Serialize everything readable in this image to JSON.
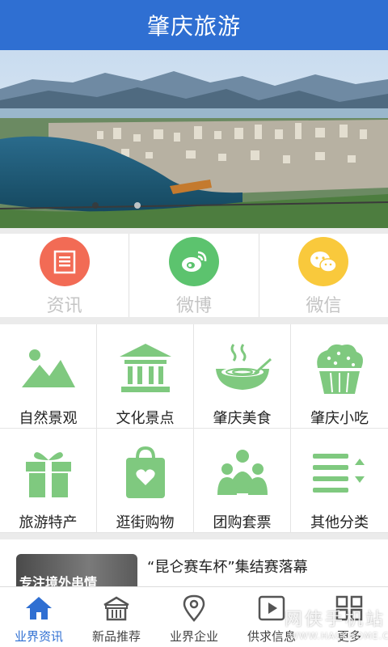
{
  "header": {
    "title": "肇庆旅游"
  },
  "banner": {
    "slides": 2,
    "active_index": 0
  },
  "social": [
    {
      "label": "资讯",
      "icon": "news-icon",
      "color": "#f26b55"
    },
    {
      "label": "微博",
      "icon": "weibo-icon",
      "color": "#5cc36e"
    },
    {
      "label": "微信",
      "icon": "wechat-icon",
      "color": "#f9c93c"
    }
  ],
  "categories": [
    {
      "label": "自然景观",
      "icon": "landscape-icon"
    },
    {
      "label": "文化景点",
      "icon": "temple-icon"
    },
    {
      "label": "肇庆美食",
      "icon": "noodle-bowl-icon"
    },
    {
      "label": "肇庆小吃",
      "icon": "cupcake-icon"
    },
    {
      "label": "旅游特产",
      "icon": "gift-icon"
    },
    {
      "label": "逛街购物",
      "icon": "shopping-bag-icon"
    },
    {
      "label": "团购套票",
      "icon": "group-icon"
    },
    {
      "label": "其他分类",
      "icon": "sort-list-icon"
    }
  ],
  "accent_green": "#7fc97f",
  "news": {
    "title": "“昆仑赛车杯”集结赛落幕",
    "thumb_text": "专注境外串情"
  },
  "tabbar": [
    {
      "label": "业界资讯",
      "icon": "home-icon",
      "active": true
    },
    {
      "label": "新品推荐",
      "icon": "shop-icon",
      "active": false
    },
    {
      "label": "业界企业",
      "icon": "location-pin-icon",
      "active": false
    },
    {
      "label": "供求信息",
      "icon": "play-icon",
      "active": false
    },
    {
      "label": "更多",
      "icon": "grid-icon",
      "active": false
    }
  ],
  "watermark": {
    "text": "网侠手机站",
    "url": "WWW.HACKHOME.COM"
  }
}
